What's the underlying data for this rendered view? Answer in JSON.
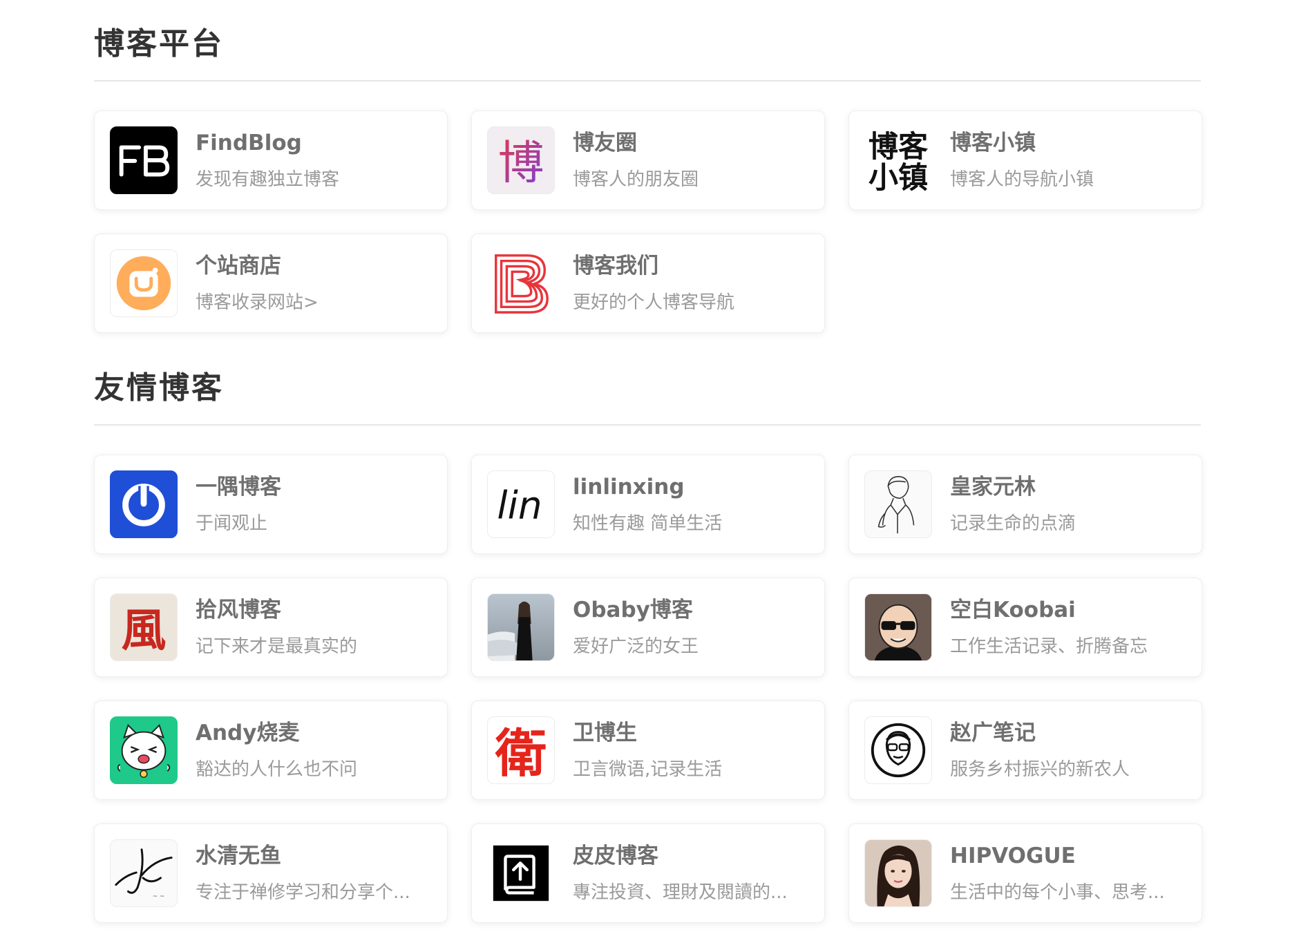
{
  "sections": [
    {
      "title": "博客平台",
      "items": [
        {
          "name": "FindBlog",
          "desc": "发现有趣独立博客",
          "icon": "fb-logo-icon"
        },
        {
          "name": "博友圈",
          "desc": "博客人的朋友圈",
          "icon": "bo-character-icon"
        },
        {
          "name": "博客小镇",
          "desc": "博客人的导航小镇",
          "icon": "blog-town-icon",
          "icon_text_1": "博客",
          "icon_text_2": "小镇"
        },
        {
          "name": "个站商店",
          "desc": "博客收录网站>",
          "icon": "shop-bag-icon"
        },
        {
          "name": "博客我们",
          "desc": "更好的个人博客导航",
          "icon": "b-stripes-icon"
        }
      ]
    },
    {
      "title": "友情博客",
      "items": [
        {
          "name": "一隅博客",
          "desc": "于闻观止",
          "icon": "power-icon"
        },
        {
          "name": "linlinxing",
          "desc": "知性有趣 简单生活",
          "icon": "lin-text-icon",
          "icon_text": "lin"
        },
        {
          "name": "皇家元林",
          "desc": "记录生命的点滴",
          "icon": "sketch-portrait-icon"
        },
        {
          "name": "拾风博客",
          "desc": "记下来才是最真实的",
          "icon": "feng-character-icon",
          "icon_text": "風"
        },
        {
          "name": "Obaby博客",
          "desc": "爱好广泛的女王",
          "icon": "photo-portrait-icon"
        },
        {
          "name": "空白Koobai",
          "desc": "工作生活记录、折腾备忘",
          "icon": "sunglasses-avatar-icon"
        },
        {
          "name": "Andy烧麦",
          "desc": "豁达的人什么也不问",
          "icon": "cartoon-cat-icon"
        },
        {
          "name": "卫博生",
          "desc": "卫言微语,记录生活",
          "icon": "wei-character-icon",
          "icon_text": "衛"
        },
        {
          "name": "赵广笔记",
          "desc": "服务乡村振兴的新农人",
          "icon": "glasses-face-icon"
        },
        {
          "name": "水清无鱼",
          "desc": "专注于禅修学习和分享个...",
          "icon": "signature-icon"
        },
        {
          "name": "皮皮博客",
          "desc": "專注投資、理財及閱讀的...",
          "icon": "book-upload-icon"
        },
        {
          "name": "HIPVOGUE",
          "desc": "生活中的每个小事、思考...",
          "icon": "woman-portrait-icon"
        }
      ]
    }
  ],
  "colors": {
    "fb_bg": "#000000",
    "bo_purple": "#7b3fd6",
    "bo_red": "#e23a4c",
    "shop_orange": "#ffad5a",
    "b_red": "#e8343b",
    "power_blue": "#1f4fd6",
    "feng_red": "#c7281f",
    "cat_green": "#1ec98a",
    "wei_red": "#e5241b"
  }
}
